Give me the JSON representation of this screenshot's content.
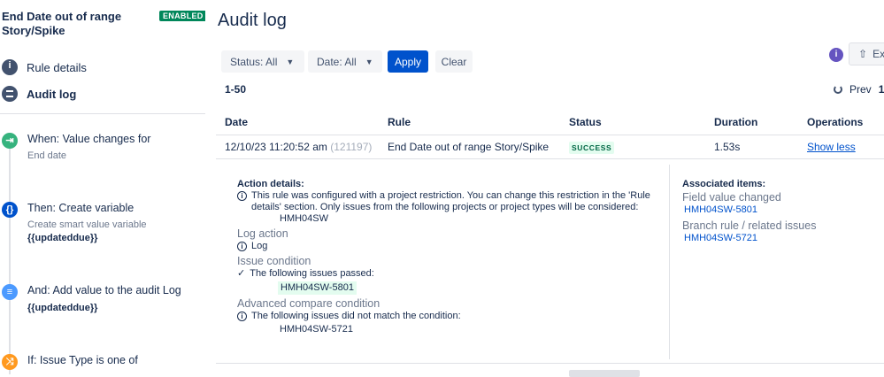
{
  "sidebar": {
    "rule_title": "End Date out of range Story/Spike",
    "status_badge": "ENABLED",
    "nav": [
      {
        "label": "Rule details",
        "icon": "info-icon"
      },
      {
        "label": "Audit log",
        "icon": "list-icon"
      }
    ],
    "steps": [
      {
        "title": "When: Value changes for",
        "sub": "End date",
        "bold": "",
        "icon": "trigger-icon",
        "color": "#36b37e"
      },
      {
        "title": "Then: Create variable",
        "sub": "Create smart value variable",
        "bold": "{{updateddue}}",
        "icon": "braces-icon",
        "color": "#0052cc"
      },
      {
        "title": "And: Add value to the audit Log",
        "sub": "",
        "bold": "{{updateddue}}",
        "icon": "log-icon",
        "color": "#4c9aff"
      },
      {
        "title": "If: Issue Type is one of",
        "sub": "",
        "bold": "",
        "icon": "shuffle-icon",
        "color": "#ff991f"
      }
    ]
  },
  "main": {
    "title": "Audit log",
    "filters": {
      "status_label": "Status: All",
      "date_label": "Date: All",
      "apply_label": "Apply",
      "clear_label": "Clear"
    },
    "export_label": "Ex",
    "range_label": "1-50",
    "pager": {
      "prev_label": "Prev",
      "page": "1"
    },
    "table": {
      "columns": [
        "Date",
        "Rule",
        "Status",
        "Duration",
        "Operations"
      ],
      "row": {
        "date": "12/10/23 11:20:52 am",
        "id": "(121197)",
        "rule": "End Date out of range Story/Spike",
        "status": "SUCCESS",
        "duration": "1.53s",
        "operation": "Show less"
      }
    },
    "details": {
      "heading": "Action details:",
      "restriction_text_1": "This rule was configured with a project restriction. You can change this restriction in the 'Rule",
      "restriction_text_2": "details' section. Only issues from the following projects or project types will be considered:",
      "project": "HMH04SW",
      "log_action_title": "Log action",
      "log_action_text": "Log",
      "issue_condition_title": "Issue condition",
      "issue_condition_text": "The following issues passed:",
      "passed_issue": "HMH04SW-5801",
      "advanced_title": "Advanced compare condition",
      "advanced_text": "The following issues did not match the condition:",
      "failed_issue": "HMH04SW-5721"
    },
    "associated": {
      "heading": "Associated items:",
      "field_changed_title": "Field value changed",
      "field_changed_item": "HMH04SW-5801",
      "branch_title": "Branch rule / related issues",
      "branch_item": "HMH04SW-5721"
    }
  }
}
